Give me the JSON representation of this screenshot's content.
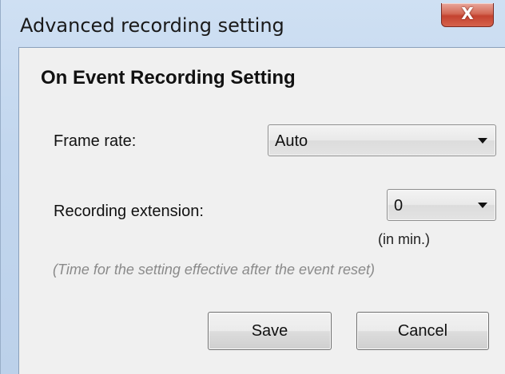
{
  "window": {
    "title": "Advanced recording setting",
    "close_glyph": "X"
  },
  "section": {
    "heading": "On Event Recording Setting"
  },
  "frame_rate": {
    "label": "Frame rate:",
    "value": "Auto"
  },
  "recording_extension": {
    "label": "Recording extension:",
    "value": "0",
    "unit": "(in min.)",
    "note": "(Time for the setting effective after the event reset)"
  },
  "buttons": {
    "save": "Save",
    "cancel": "Cancel"
  },
  "colors": {
    "title_bar": "#c2d6ee",
    "close_button": "#c44330",
    "dialog_background": "#f0f0f0",
    "note_text": "#8a8a8a"
  }
}
